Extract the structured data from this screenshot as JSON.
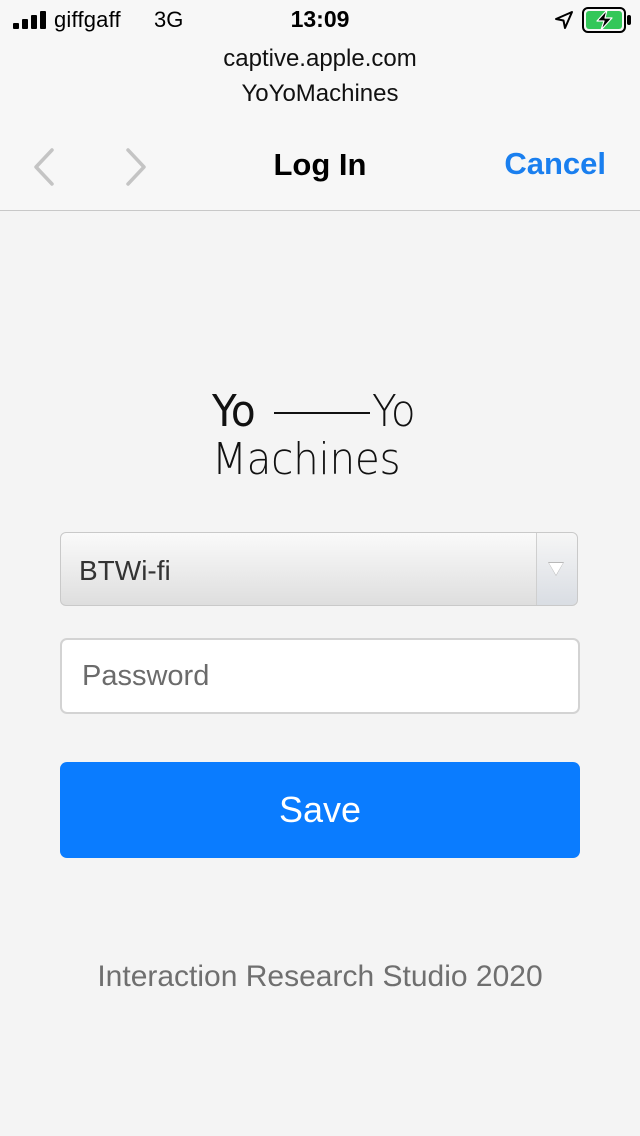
{
  "status_bar": {
    "carrier": "giffgaff",
    "network": "3G",
    "time": "13:09",
    "signal_icon": "signal-bars-icon",
    "location_icon": "location-arrow-icon",
    "battery_icon": "battery-charging-icon"
  },
  "header": {
    "domain": "captive.apple.com",
    "site_name": "YoYoMachines",
    "title": "Log In",
    "cancel_label": "Cancel",
    "back_icon": "chevron-left-icon",
    "forward_icon": "chevron-right-icon"
  },
  "logo": {
    "line1_left": "Yo",
    "line1_right": "Yo",
    "line2": "Machines"
  },
  "form": {
    "network_select": {
      "selected": "BTWi-fi"
    },
    "password": {
      "value": "",
      "placeholder": "Password"
    },
    "save_label": "Save"
  },
  "footer": {
    "text": "Interaction Research Studio 2020"
  },
  "colors": {
    "accent": "#0a7cff",
    "cancel": "#1a7fef",
    "battery": "#34c759",
    "background": "#f4f4f4"
  }
}
